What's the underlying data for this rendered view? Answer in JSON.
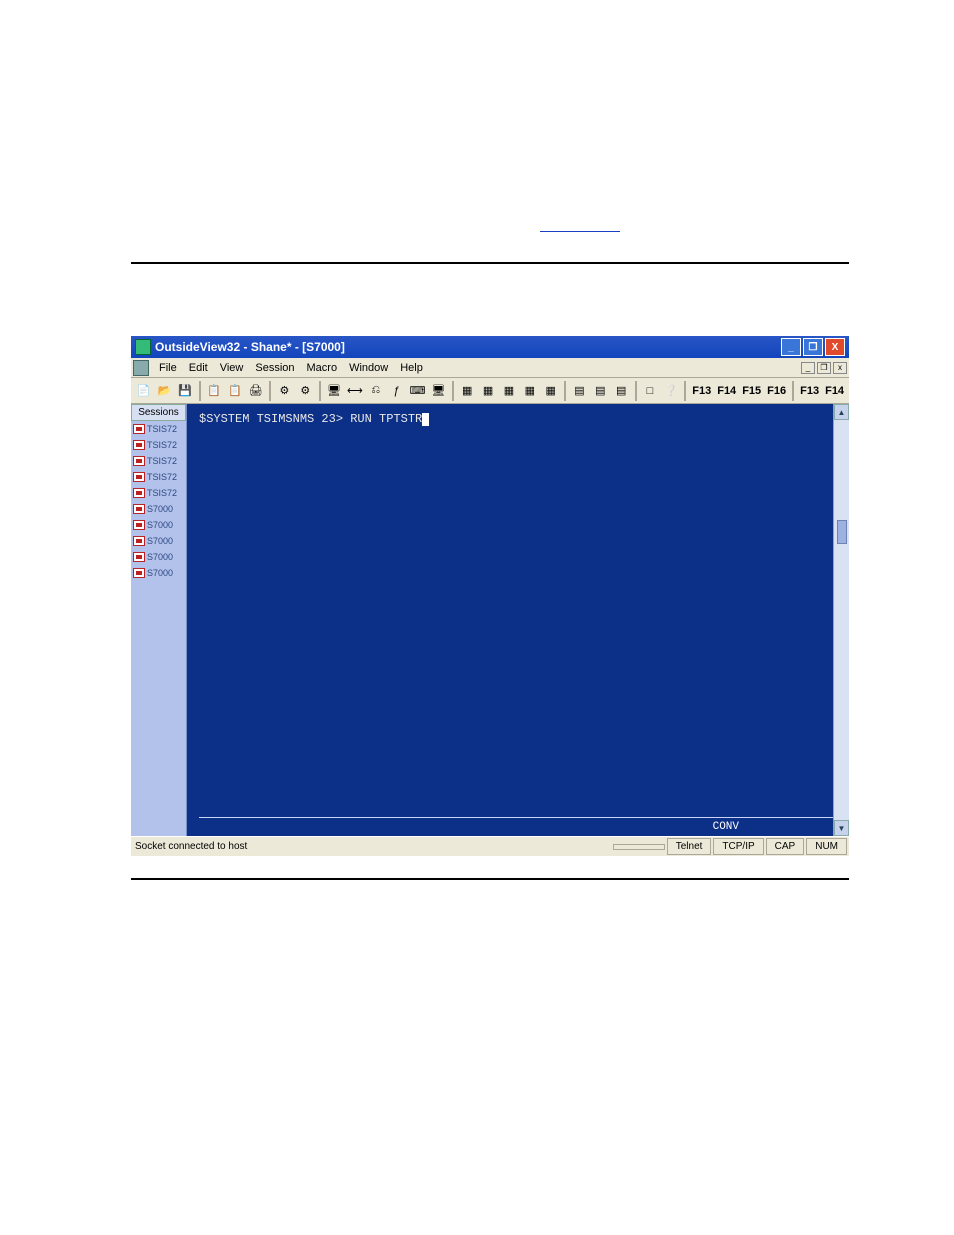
{
  "window": {
    "title": "OutsideView32 - Shane* - [S7000]",
    "controls": {
      "min": "_",
      "max": "❐",
      "close": "X"
    }
  },
  "menu": {
    "items": [
      "File",
      "Edit",
      "View",
      "Session",
      "Macro",
      "Window",
      "Help"
    ],
    "mdi": {
      "min": "_",
      "restore": "❐",
      "close": "x"
    }
  },
  "toolbar": {
    "groups": [
      [
        "📄",
        "📂",
        "💾"
      ],
      [
        "📋",
        "📋",
        "🖨"
      ],
      [
        "⚙",
        "⚙"
      ],
      [
        "🖥",
        "⟷",
        "⎌",
        "ƒ",
        "⌨",
        "🖥"
      ],
      [
        "▦",
        "▦",
        "▦",
        "▦",
        "▦"
      ],
      [
        "▤",
        "▤",
        "▤"
      ],
      [
        "□",
        "❔"
      ]
    ],
    "fkeys_a": [
      "F13",
      "F14",
      "F15",
      "F16"
    ],
    "fkeys_b": [
      "F13",
      "F14"
    ]
  },
  "sidebar": {
    "header": "Sessions",
    "items": [
      {
        "label": "TSIS72"
      },
      {
        "label": "TSIS72"
      },
      {
        "label": "TSIS72"
      },
      {
        "label": "TSIS72"
      },
      {
        "label": "TSIS72"
      },
      {
        "label": "S7000"
      },
      {
        "label": "S7000"
      },
      {
        "label": "S7000"
      },
      {
        "label": "S7000"
      },
      {
        "label": "S7000"
      }
    ]
  },
  "terminal": {
    "prompt": "$SYSTEM TSIMSNMS 23> RUN TPTSTR",
    "conv": "CONV"
  },
  "status": {
    "message": "Socket connected to host",
    "cells": [
      "Telnet",
      "TCP/IP",
      "CAP",
      "NUM"
    ]
  }
}
